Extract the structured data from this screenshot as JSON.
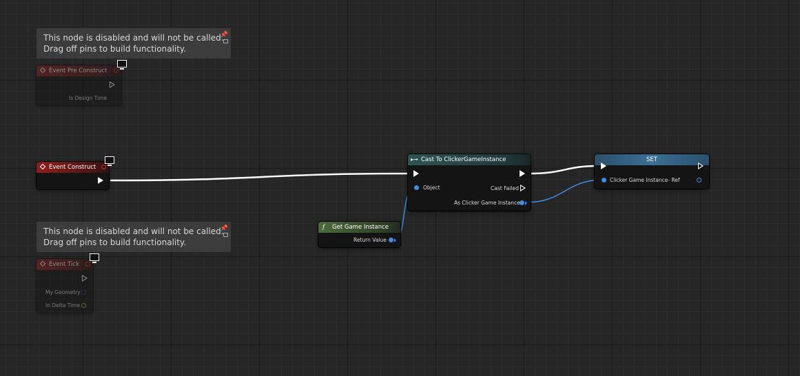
{
  "comments": {
    "pre_construct": {
      "line1": "This node is disabled and will not be called.",
      "line2": "Drag off pins to build functionality."
    },
    "tick": {
      "line1": "This node is disabled and will not be called.",
      "line2": "Drag off pins to build functionality."
    }
  },
  "nodes": {
    "event_pre_construct": {
      "title": "Event Pre Construct",
      "pin_is_design_time": "Is Design Time"
    },
    "event_construct": {
      "title": "Event Construct"
    },
    "event_tick": {
      "title": "Event Tick",
      "pin_my_geometry": "My Geometry",
      "pin_in_delta_time": "In Delta Time"
    },
    "cast": {
      "title": "Cast To ClickerGameInstance",
      "pin_object": "Object",
      "pin_cast_failed": "Cast Failed",
      "pin_as_instance": "As Clicker Game Instance"
    },
    "get_game_instance": {
      "title": "Get Game Instance",
      "pin_return_value": "Return Value"
    },
    "set": {
      "title": "SET",
      "pin_ref": "Clicker Game Instance- Ref"
    }
  },
  "colors": {
    "event_header": "#8d1f1f",
    "cast_header": "#2f5552",
    "function_header": "#4e6b3c",
    "set_header": "#3b6f94",
    "object_pin": "#3d8fe6",
    "exec_wire": "#ffffff"
  },
  "icons": {
    "event": "diamond-icon",
    "monitor": "monitor-icon",
    "function": "function-icon",
    "pin": "pushpin-icon"
  }
}
